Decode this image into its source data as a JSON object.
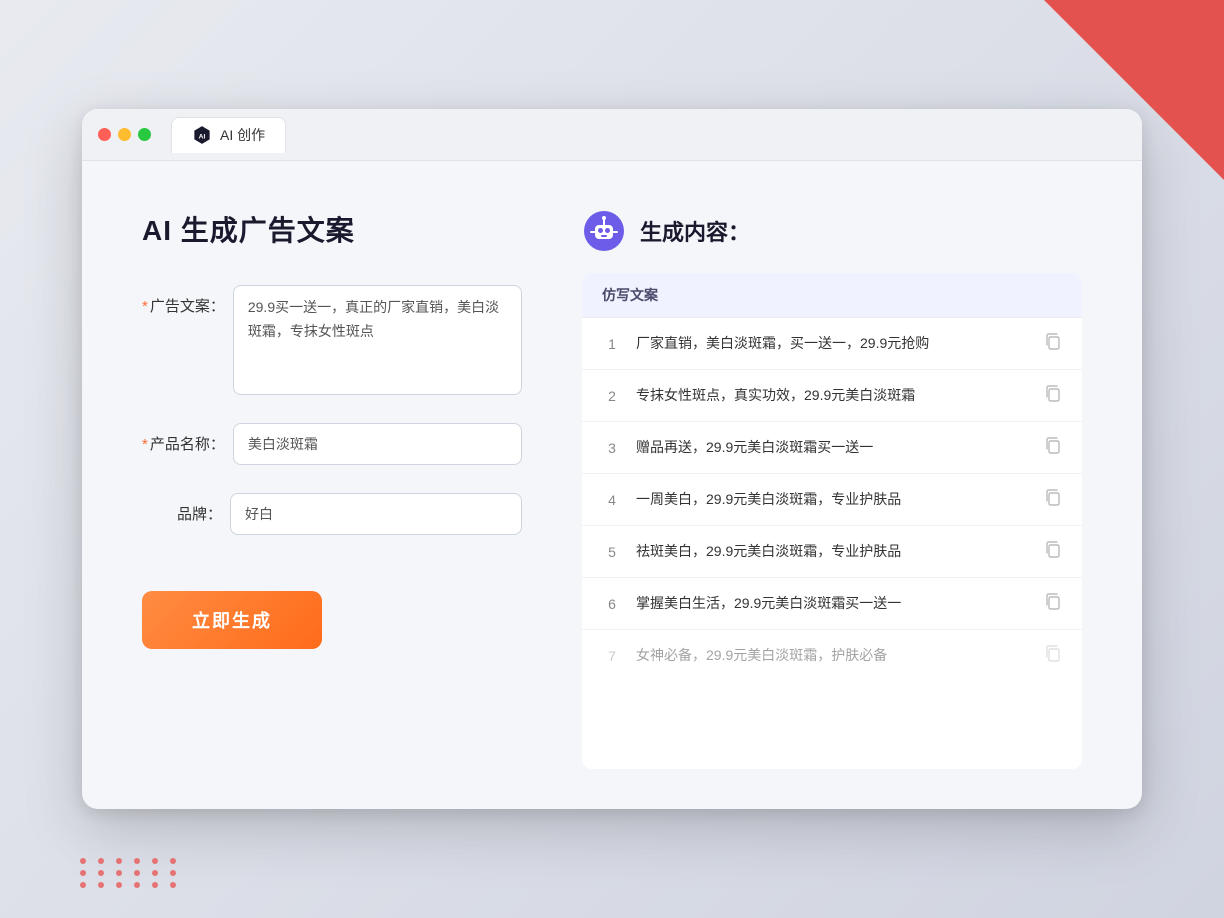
{
  "background": {
    "color": "#dde0ea"
  },
  "browser": {
    "tab_label": "AI 创作"
  },
  "left_panel": {
    "page_title": "AI 生成广告文案",
    "form": {
      "ad_copy_label": "广告文案：",
      "ad_copy_required": "*",
      "ad_copy_value": "29.9买一送一，真正的厂家直销，美白淡斑霜，专抹女性斑点",
      "product_label": "产品名称：",
      "product_required": "*",
      "product_value": "美白淡斑霜",
      "brand_label": "品牌：",
      "brand_value": "好白"
    },
    "generate_button": "立即生成"
  },
  "right_panel": {
    "title": "生成内容：",
    "table_header": "仿写文案",
    "results": [
      {
        "num": "1",
        "text": "厂家直销，美白淡斑霜，买一送一，29.9元抢购",
        "dimmed": false
      },
      {
        "num": "2",
        "text": "专抹女性斑点，真实功效，29.9元美白淡斑霜",
        "dimmed": false
      },
      {
        "num": "3",
        "text": "赠品再送，29.9元美白淡斑霜买一送一",
        "dimmed": false
      },
      {
        "num": "4",
        "text": "一周美白，29.9元美白淡斑霜，专业护肤品",
        "dimmed": false
      },
      {
        "num": "5",
        "text": "祛斑美白，29.9元美白淡斑霜，专业护肤品",
        "dimmed": false
      },
      {
        "num": "6",
        "text": "掌握美白生活，29.9元美白淡斑霜买一送一",
        "dimmed": false
      },
      {
        "num": "7",
        "text": "女神必备，29.9元美白淡斑霜，护肤必备",
        "dimmed": true
      }
    ]
  }
}
